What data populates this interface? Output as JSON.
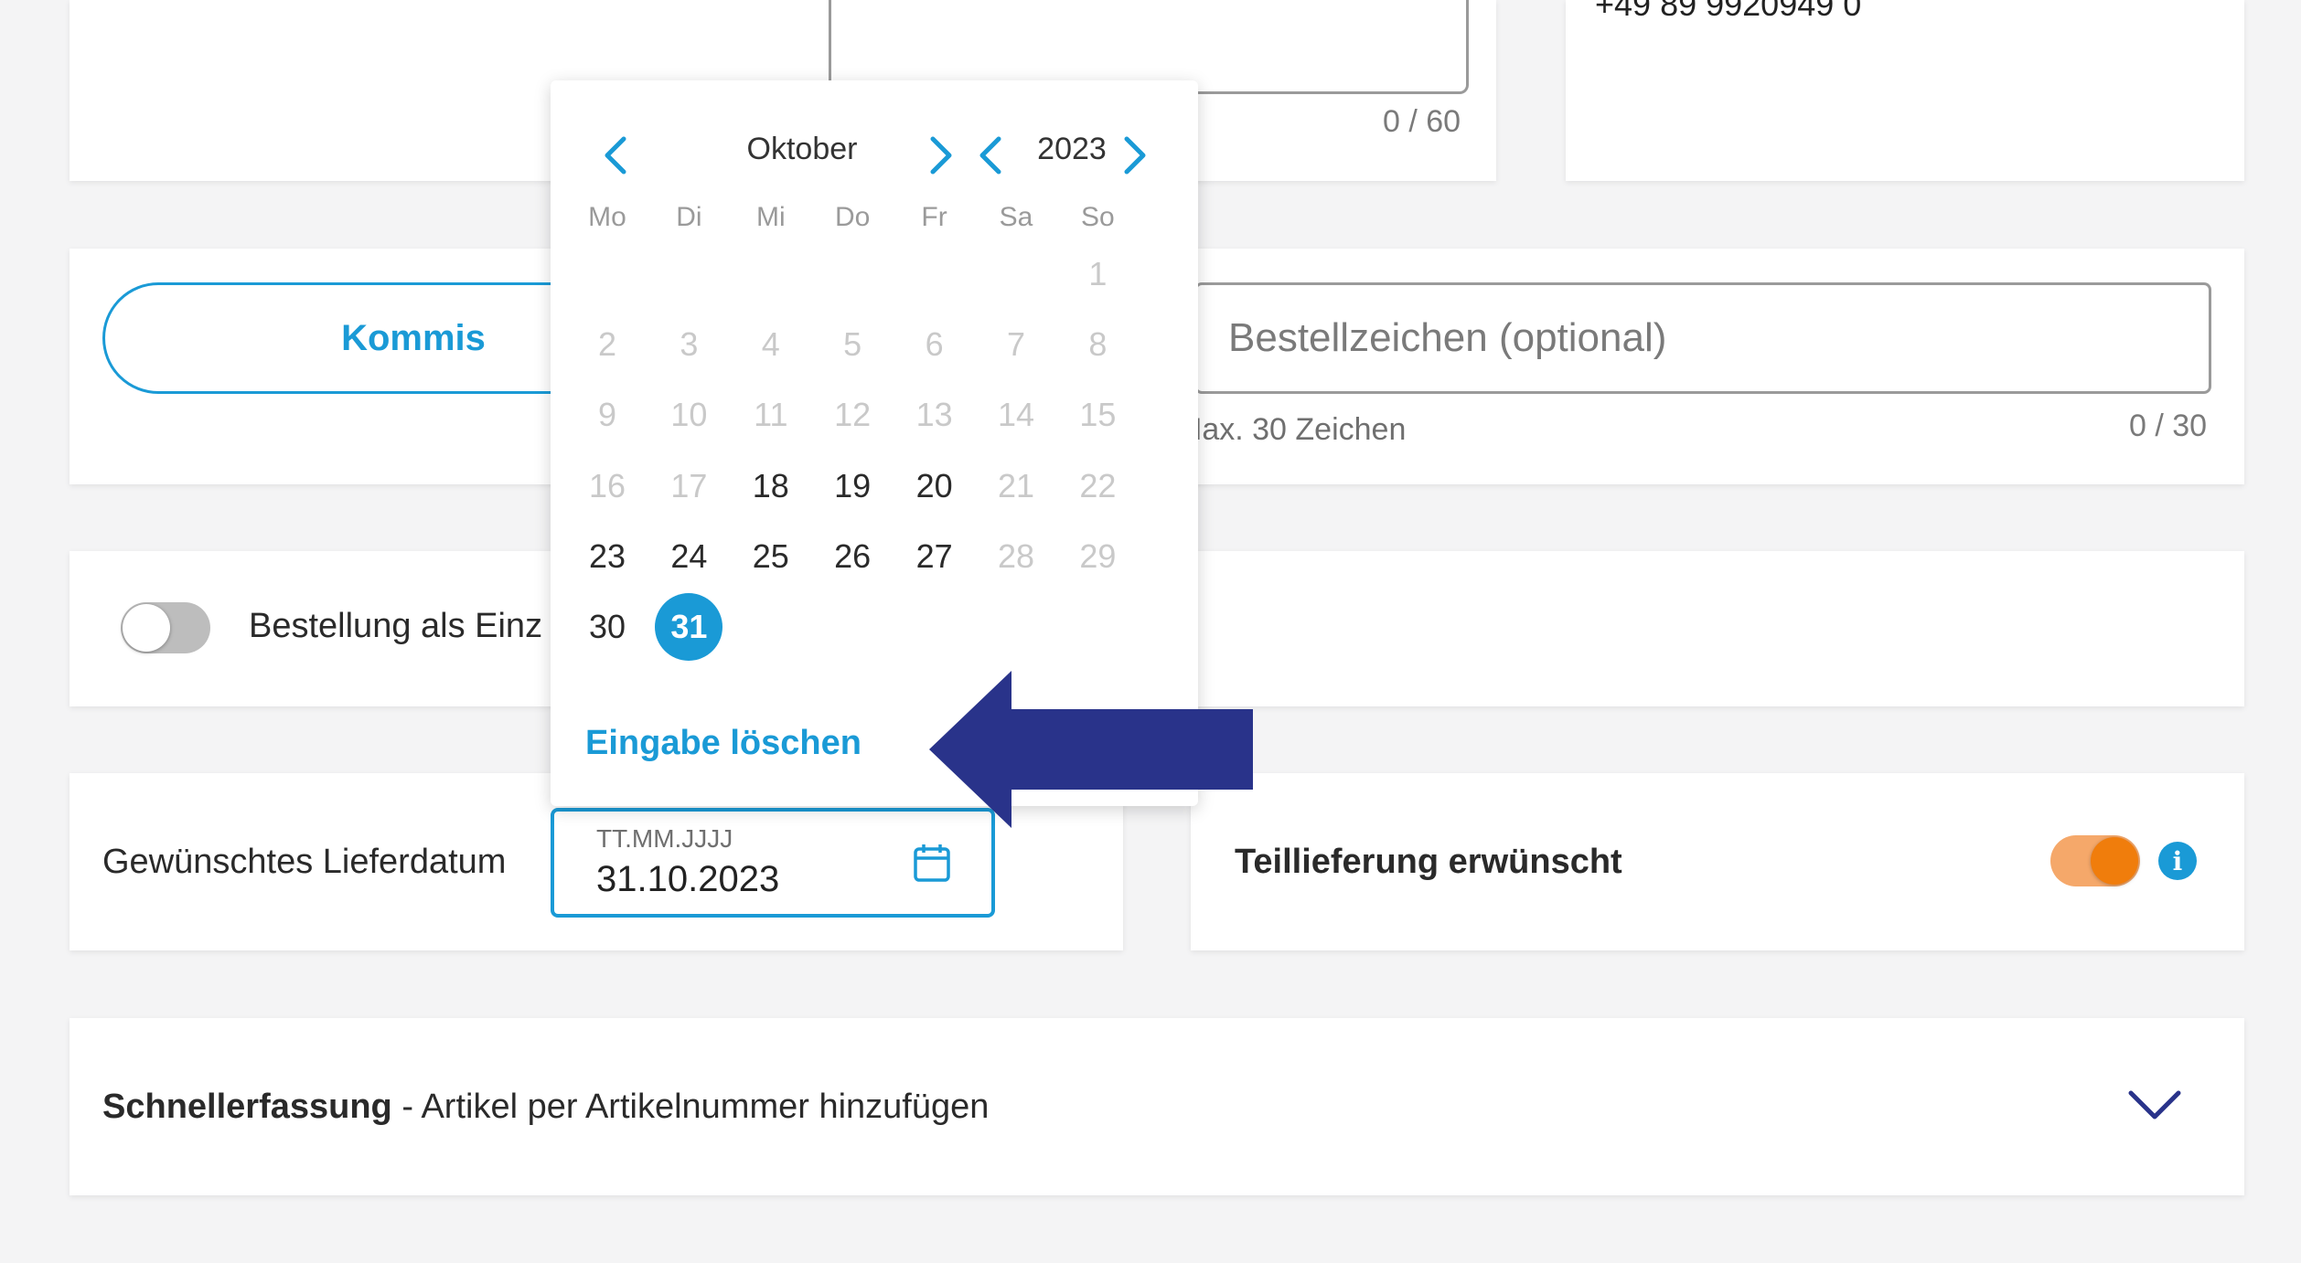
{
  "top": {
    "description_counter": "0 / 60",
    "phone": "+49 89 9920949 0"
  },
  "order_ref": {
    "kommission_label": "Kommis",
    "bestellzeichen_placeholder": "Bestellzeichen (optional)",
    "hint": "Max. 30 Zeichen",
    "counter": "0 / 30"
  },
  "single_order": {
    "label": "Bestellung als Einz"
  },
  "datepicker": {
    "month": "Oktober",
    "year": "2023",
    "weekdays": [
      "Mo",
      "Di",
      "Mi",
      "Do",
      "Fr",
      "Sa",
      "So"
    ],
    "weeks": [
      [
        "",
        "",
        "",
        "",
        "",
        "",
        "1"
      ],
      [
        "2",
        "3",
        "4",
        "5",
        "6",
        "7",
        "8"
      ],
      [
        "9",
        "10",
        "11",
        "12",
        "13",
        "14",
        "15"
      ],
      [
        "16",
        "17",
        "18",
        "19",
        "20",
        "21",
        "22"
      ],
      [
        "23",
        "24",
        "25",
        "26",
        "27",
        "28",
        "29"
      ],
      [
        "30",
        "31",
        "",
        "",
        "",
        "",
        ""
      ]
    ],
    "enabled_days": [
      "18",
      "19",
      "20",
      "23",
      "24",
      "25",
      "26",
      "27",
      "30",
      "31"
    ],
    "selected_day": "31",
    "clear_label": "Eingabe löschen"
  },
  "delivery": {
    "label": "Gewünschtes Lieferdatum",
    "date_placeholder": "TT.MM.JJJJ",
    "date_value": "31.10.2023",
    "partial_label": "Teillieferung erwünscht",
    "partial_enabled": true
  },
  "quick_entry": {
    "title": "Schnellerfassung",
    "subtitle": " - Artikel per Artikelnummer hinzufügen"
  },
  "colors": {
    "accent": "#1a9ad6",
    "toggle_on": "#f07d0c",
    "arrow": "#29338a"
  }
}
